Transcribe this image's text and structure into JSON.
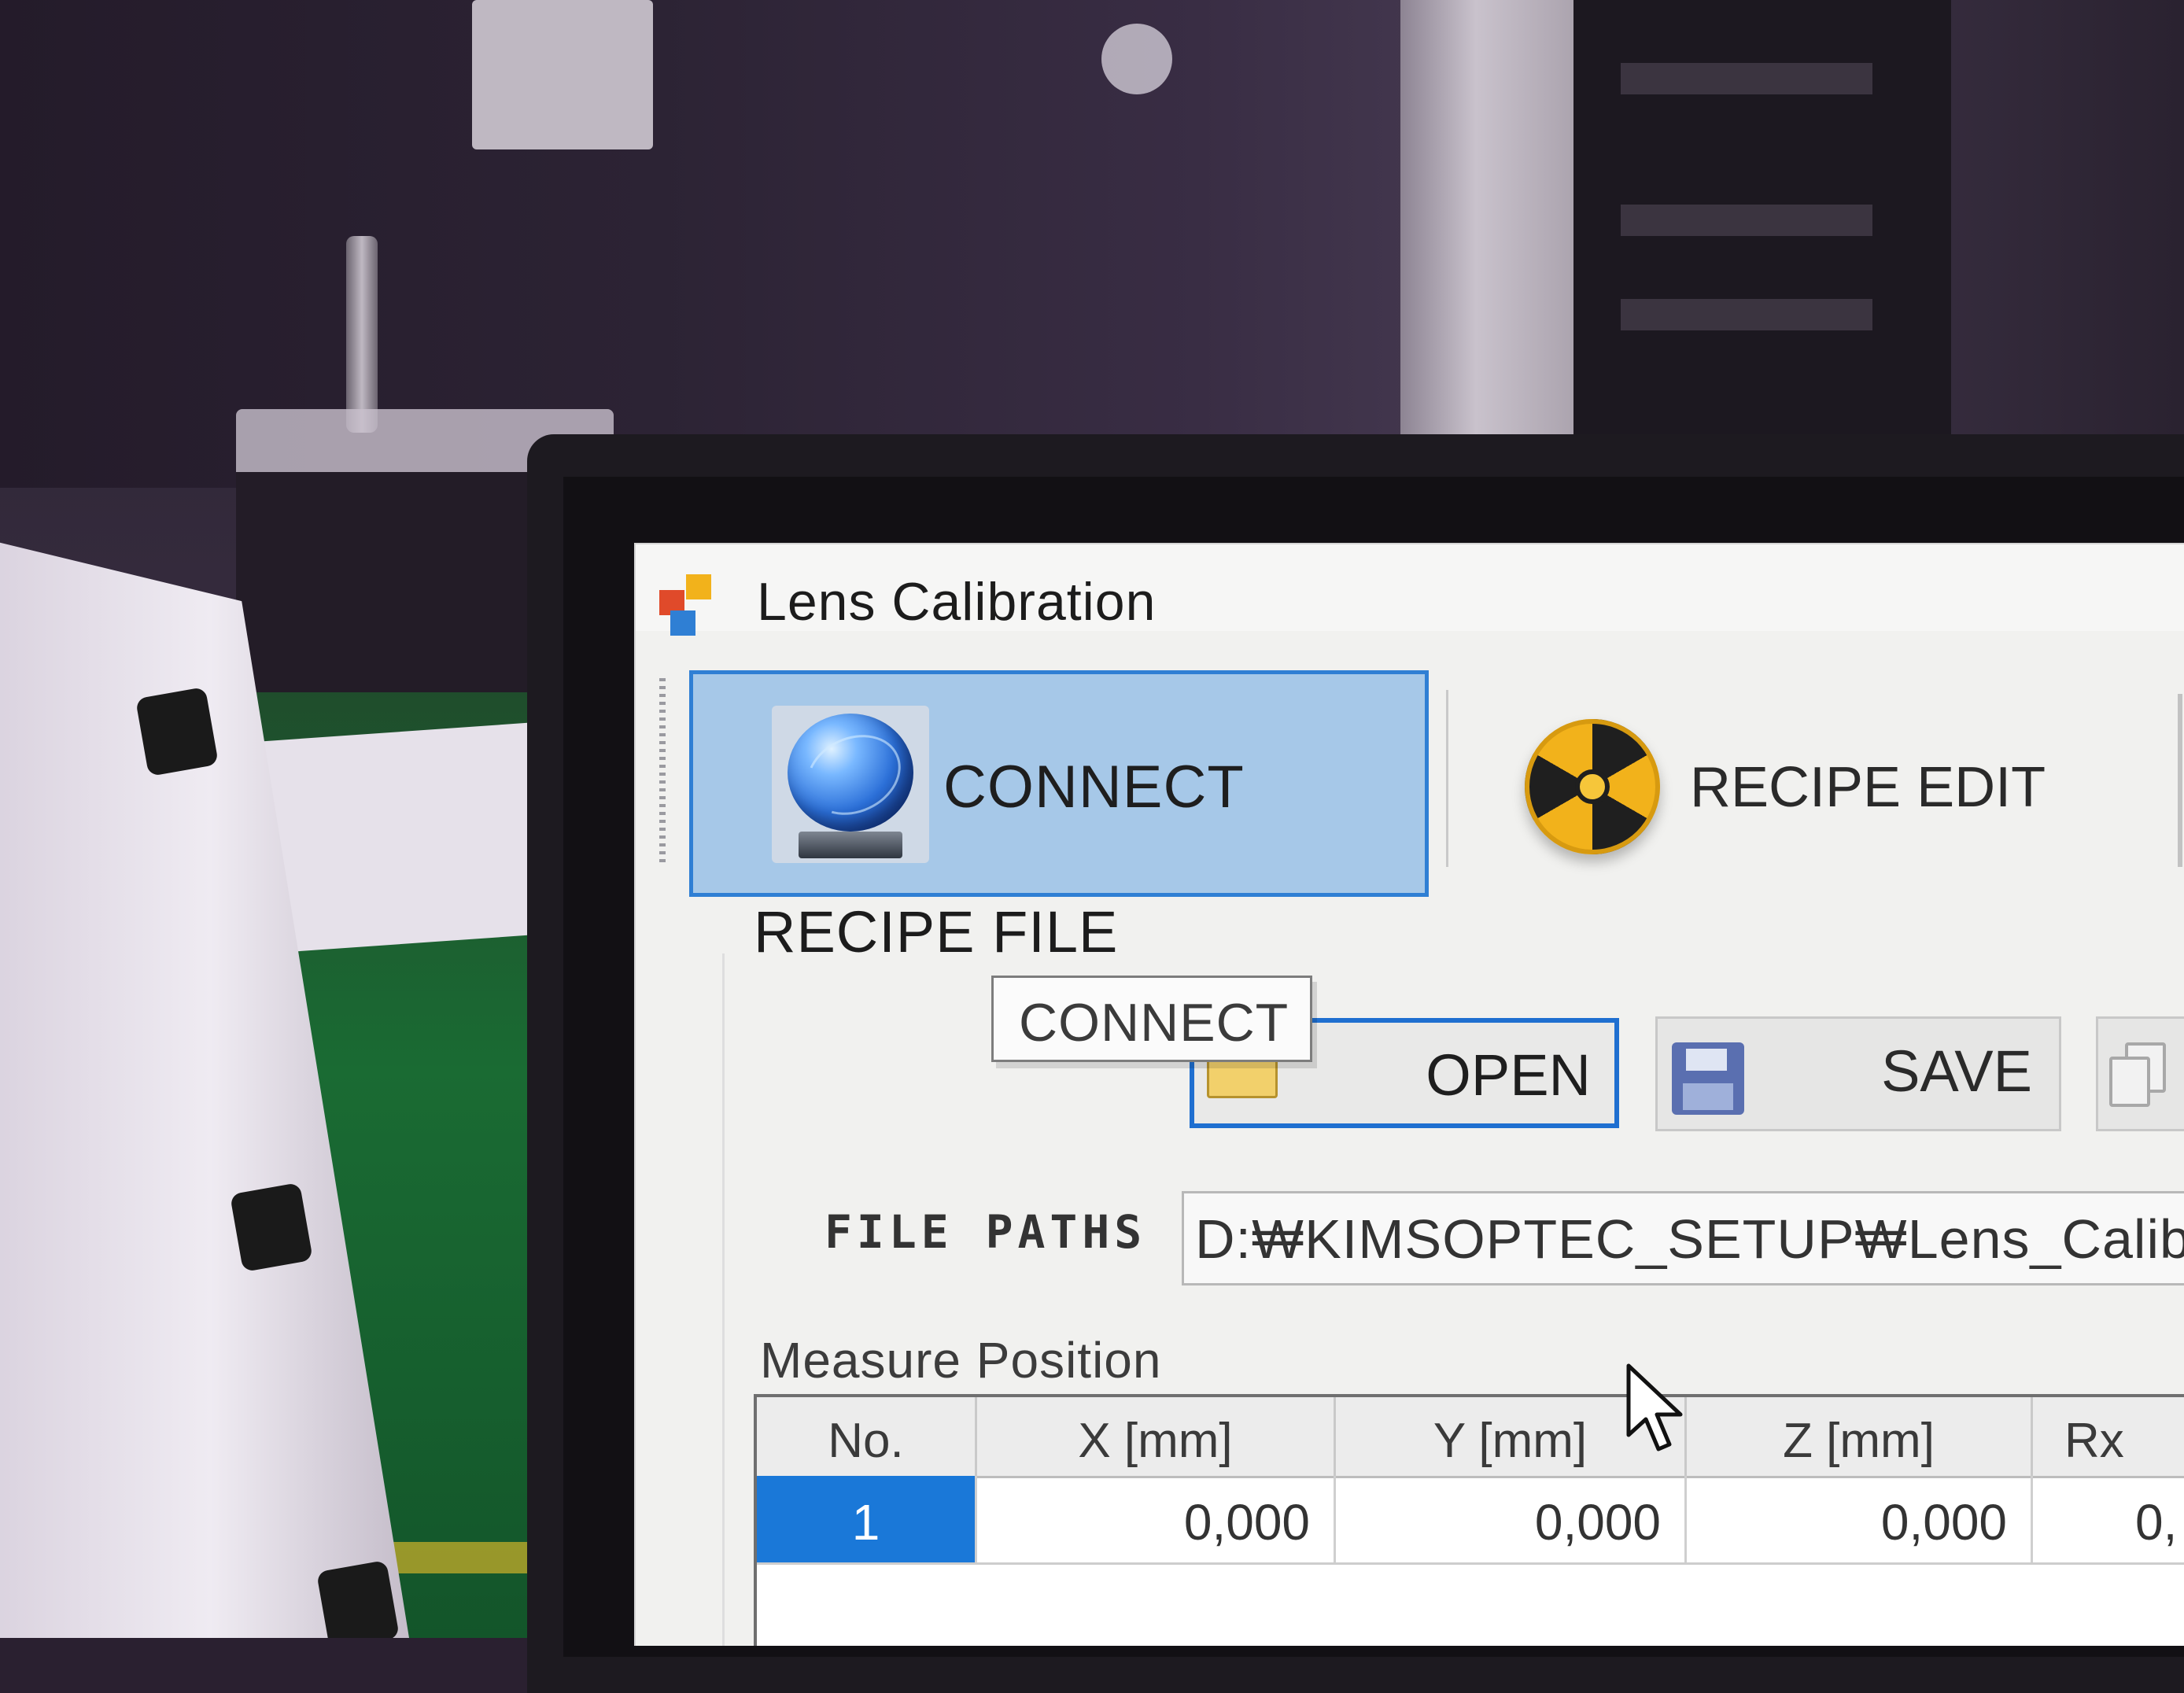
{
  "window": {
    "title": "Lens Calibration"
  },
  "toolbar": {
    "connect_label": "CONNECT",
    "recipe_edit_label": "RECIPE EDIT"
  },
  "tooltip": {
    "text": "CONNECT"
  },
  "recipe_file": {
    "group_label": "RECIPE FILE",
    "open_label": "OPEN",
    "save_label": "SAVE",
    "file_paths_label": "FILE PATHS",
    "file_path_value": "D:₩KIMSOPTEC_SETUP₩Lens_Calibr"
  },
  "measure_position": {
    "label": "Measure Position",
    "columns": [
      "No.",
      "X [mm]",
      "Y [mm]",
      "Z [mm]",
      "Rx"
    ],
    "rows": [
      {
        "no": "1",
        "x": "0,000",
        "y": "0,000",
        "z": "0,000",
        "rx": "0,"
      }
    ]
  },
  "colors": {
    "selected_button": "#a6c8e8",
    "selection_border": "#2f7fd4",
    "selected_cell": "#1a78d8"
  },
  "icons": {
    "connect": "globe-icon",
    "recipe_edit": "hazard-icon",
    "open": "folder-icon",
    "save": "floppy-disk-icon",
    "copy": "copy-icon"
  }
}
